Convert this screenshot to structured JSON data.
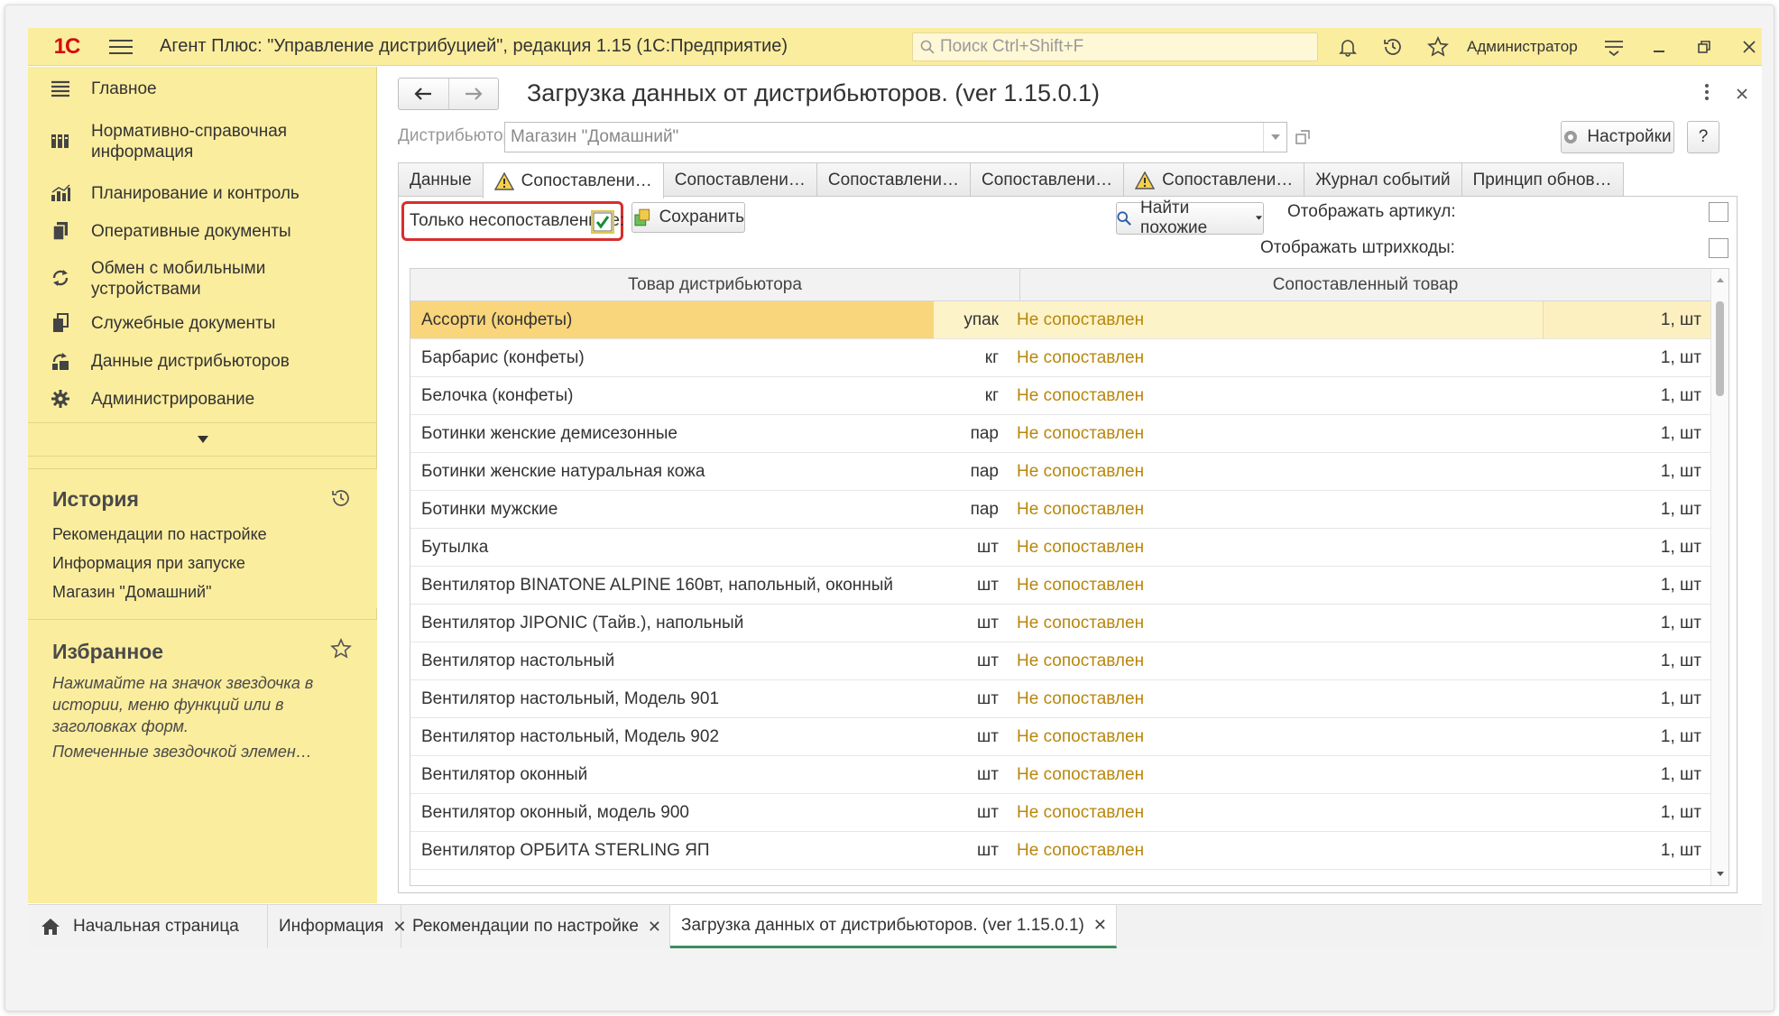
{
  "window": {
    "logo": "1С",
    "title": "Агент Плюс: \"Управление дистрибуцией\", редакция 1.15  (1С:Предприятие)",
    "search_placeholder": "Поиск Ctrl+Shift+F",
    "user": "Администратор"
  },
  "sidebar": {
    "items": [
      {
        "label": "Главное",
        "icon": "menu-lines-icon"
      },
      {
        "label": "Нормативно-справочная информация",
        "icon": "ref-books-icon"
      },
      {
        "label": "Планирование и контроль",
        "icon": "bar-chart-icon"
      },
      {
        "label": "Оперативные документы",
        "icon": "documents-icon"
      },
      {
        "label": "Обмен с мобильными устройствами",
        "icon": "sync-icon"
      },
      {
        "label": "Служебные документы",
        "icon": "service-docs-icon"
      },
      {
        "label": "Данные дистрибьюторов",
        "icon": "distributor-data-icon"
      },
      {
        "label": "Администрирование",
        "icon": "gear-icon"
      }
    ],
    "history": {
      "title": "История",
      "links": [
        "Рекомендации по настройке",
        "Информация при запуске",
        "Магазин \"Домашний\""
      ]
    },
    "favorites": {
      "title": "Избранное",
      "hint": "Нажимайте на значок звездочка в истории, меню функций или в заголовках форм.",
      "hint2": "Помеченные звездочкой элемен…"
    }
  },
  "form": {
    "title": "Загрузка данных от дистрибьюторов. (ver 1.15.0.1)",
    "distributor_label": "Дистрибьютор:",
    "distributor_value": "Магазин \"Домашний\"",
    "settings_button": "Настройки",
    "help_button": "?",
    "tabs": [
      {
        "label": "Данные",
        "warn": false
      },
      {
        "label": "Сопоставлени…",
        "warn": true
      },
      {
        "label": "Сопоставлени…",
        "warn": false
      },
      {
        "label": "Сопоставлени…",
        "warn": false
      },
      {
        "label": "Сопоставлени…",
        "warn": false
      },
      {
        "label": "Сопоставлени…",
        "warn": true
      },
      {
        "label": "Журнал событий",
        "warn": false
      },
      {
        "label": "Принцип обнов…",
        "warn": false
      }
    ],
    "only_unmatched_label": "Только несопоставленные:",
    "only_unmatched_checked": true,
    "save_button": "Сохранить",
    "find_similar_button": "Найти похожие",
    "show_article_label": "Отображать артикул:",
    "show_barcodes_label": "Отображать штрихкоды:",
    "table": {
      "headers": [
        "Товар дистрибьютора",
        "Сопоставленный товар"
      ],
      "rows": [
        {
          "name": "Ассорти (конфеты)",
          "unit": "упак",
          "matched": "Не сопоставлен",
          "qty": "1, шт"
        },
        {
          "name": "Барбарис (конфеты)",
          "unit": "кг",
          "matched": "Не сопоставлен",
          "qty": "1, шт"
        },
        {
          "name": "Белочка (конфеты)",
          "unit": "кг",
          "matched": "Не сопоставлен",
          "qty": "1, шт"
        },
        {
          "name": "Ботинки женские демисезонные",
          "unit": "пар",
          "matched": "Не сопоставлен",
          "qty": "1, шт"
        },
        {
          "name": "Ботинки женские натуральная кожа",
          "unit": "пар",
          "matched": "Не сопоставлен",
          "qty": "1, шт"
        },
        {
          "name": "Ботинки мужские",
          "unit": "пар",
          "matched": "Не сопоставлен",
          "qty": "1, шт"
        },
        {
          "name": "Бутылка",
          "unit": "шт",
          "matched": "Не сопоставлен",
          "qty": "1, шт"
        },
        {
          "name": "Вентилятор BINATONE ALPINE 160вт, напольный, оконный",
          "unit": "шт",
          "matched": "Не сопоставлен",
          "qty": "1, шт"
        },
        {
          "name": "Вентилятор JIPONIC (Тайв.), напольный",
          "unit": "шт",
          "matched": "Не сопоставлен",
          "qty": "1, шт"
        },
        {
          "name": "Вентилятор настольный",
          "unit": "шт",
          "matched": "Не сопоставлен",
          "qty": "1, шт"
        },
        {
          "name": "Вентилятор настольный, Модель 901",
          "unit": "шт",
          "matched": "Не сопоставлен",
          "qty": "1, шт"
        },
        {
          "name": "Вентилятор настольный, Модель 902",
          "unit": "шт",
          "matched": "Не сопоставлен",
          "qty": "1, шт"
        },
        {
          "name": "Вентилятор оконный",
          "unit": "шт",
          "matched": "Не сопоставлен",
          "qty": "1, шт"
        },
        {
          "name": "Вентилятор оконный, модель 900",
          "unit": "шт",
          "matched": "Не сопоставлен",
          "qty": "1, шт"
        },
        {
          "name": "Вентилятор ОРБИТА STERLING ЯП",
          "unit": "шт",
          "matched": "Не сопоставлен",
          "qty": "1, шт"
        }
      ]
    }
  },
  "bottom_tabs": [
    {
      "label": "Начальная страница",
      "closable": false
    },
    {
      "label": "Информация",
      "closable": true
    },
    {
      "label": "Рекомендации по настройке",
      "closable": true
    },
    {
      "label": "Загрузка данных от дистрибьюторов. (ver 1.15.0.1)",
      "closable": true
    }
  ],
  "colors": {
    "panel_yellow": "#fbed9e",
    "selected_cell": "#f9d57b",
    "unmatched_text": "#b8860b",
    "highlight_red": "#d92d2d",
    "active_tab_underline": "#3a8f5c"
  }
}
